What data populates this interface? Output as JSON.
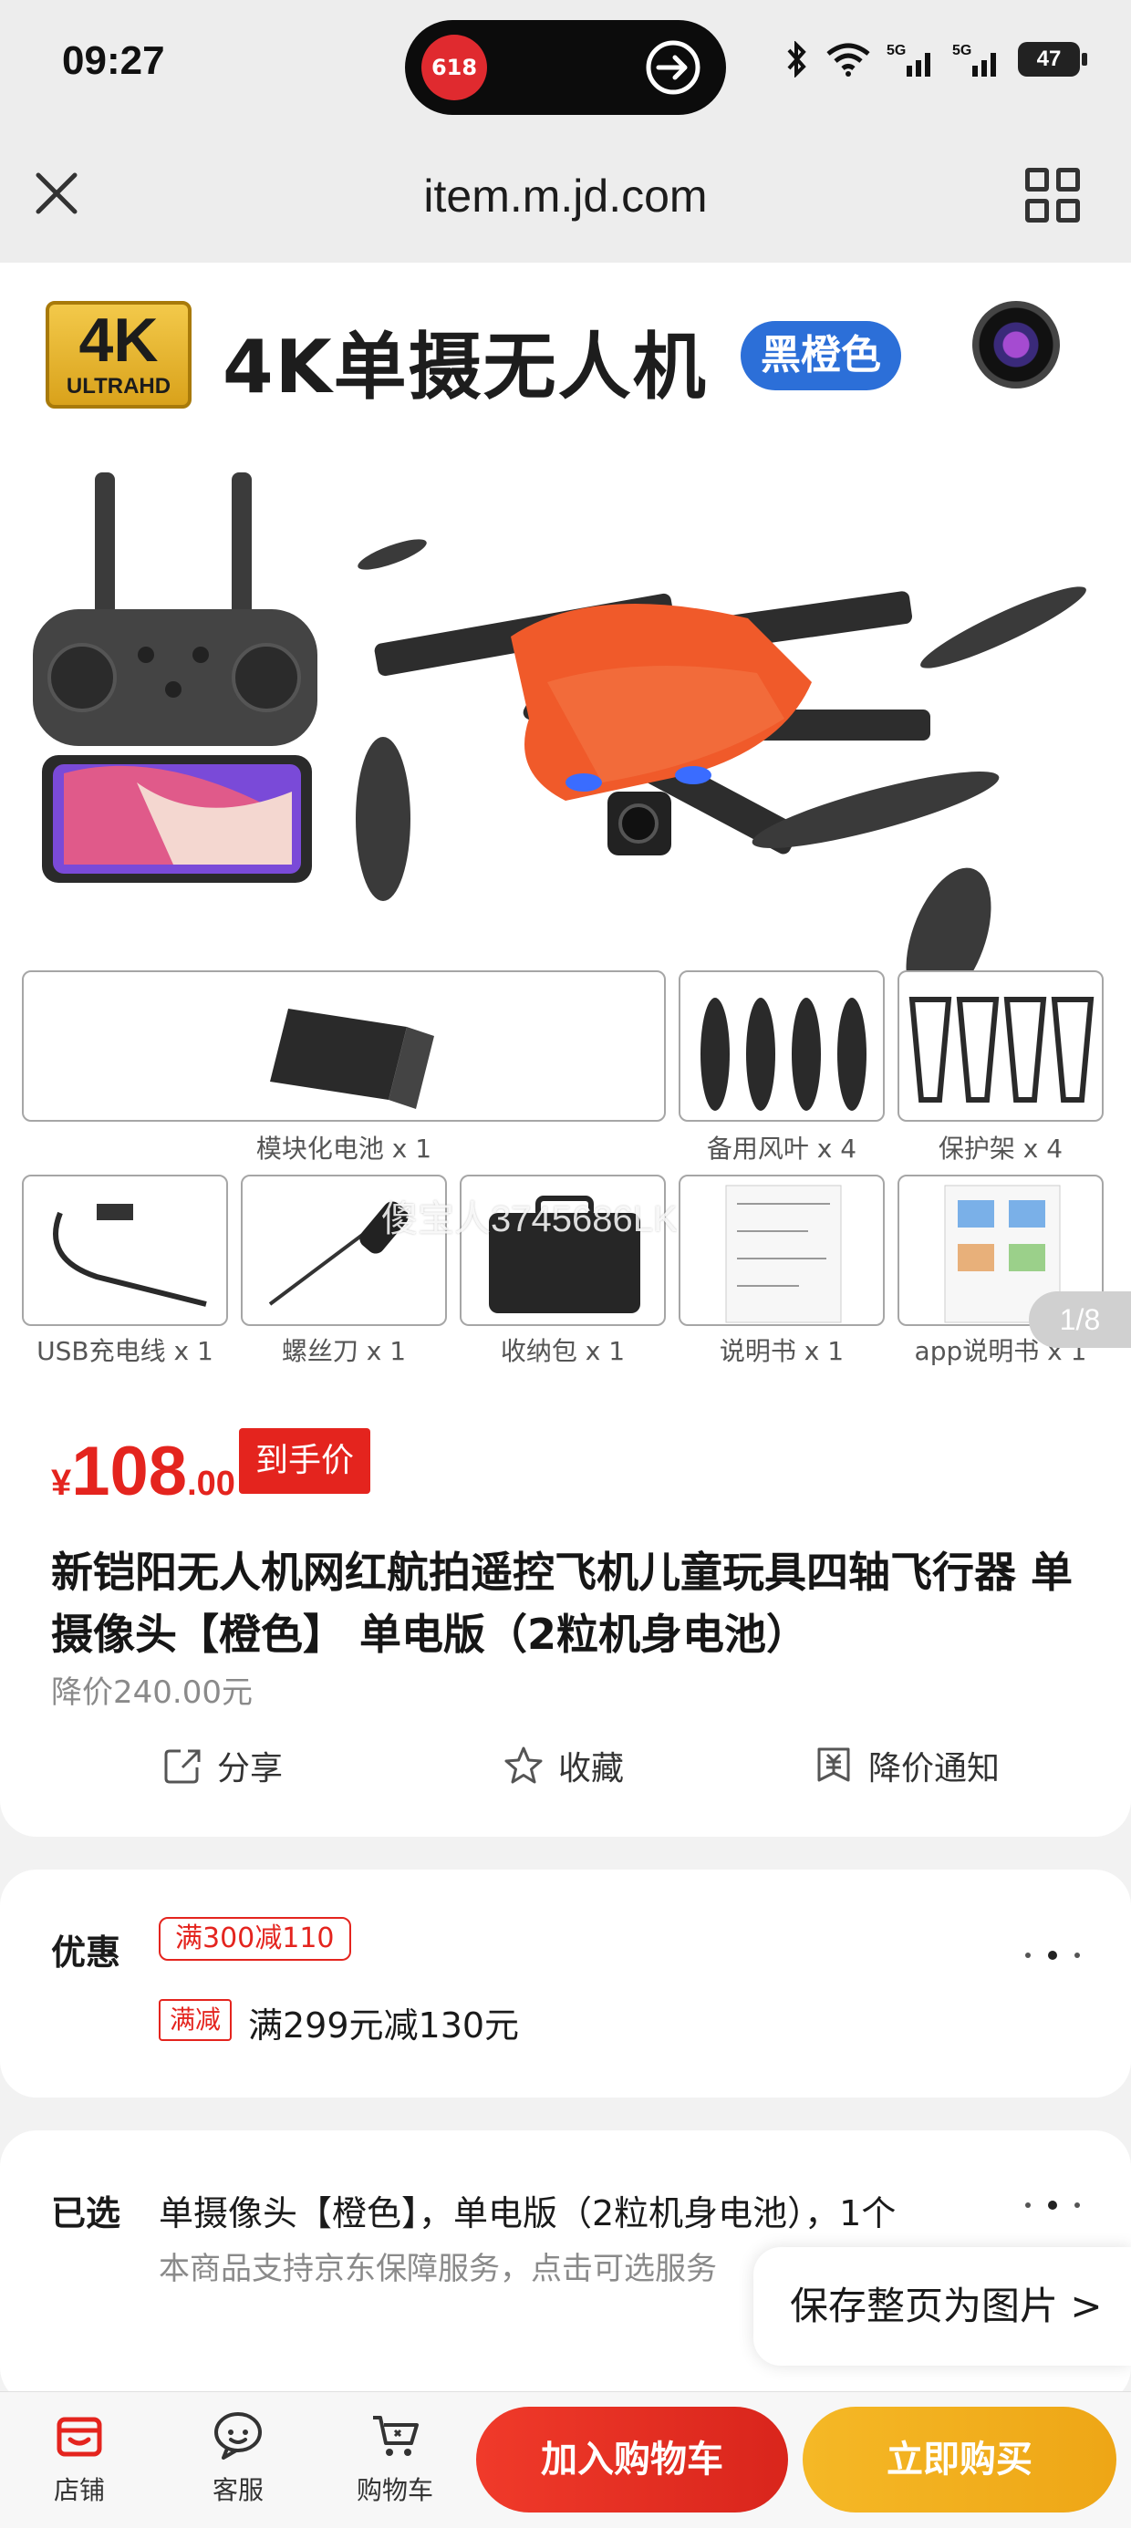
{
  "status_bar": {
    "time": "09:27",
    "battery": "47",
    "island_badge": "618"
  },
  "browser": {
    "url": "item.m.jd.com"
  },
  "product_image": {
    "hero_title": "4K单摄无人机",
    "badge_4k": "4K",
    "badge_ultrahd": "ULTRAHD",
    "color_pill": "黑橙色",
    "watermark": "傻宝人3745686LK",
    "pager": "1/8",
    "accessories": [
      "模块化电池 x 1",
      "备用风叶 x 4",
      "保护架 x 4",
      "USB充电线 x 1",
      "螺丝刀 x 1",
      "收纳包 x 1",
      "说明书 x 1",
      "app说明书 x 1"
    ]
  },
  "price": {
    "currency": "¥",
    "integer": "108",
    "decimal": ".00",
    "tag": "到手价",
    "original": "降价240.00元"
  },
  "title": "新铠阳无人机网红航拍遥控飞机儿童玩具四轴飞行器 单摄像头【橙色】 单电版（2粒机身电池）",
  "actions": {
    "share": "分享",
    "favorite": "收藏",
    "price_alert": "降价通知"
  },
  "promo": {
    "label": "优惠",
    "coupon": "满300减110",
    "tag": "满减",
    "text": "满299元减130元"
  },
  "selected": {
    "label": "已选",
    "value": "单摄像头【橙色】，单电版（2粒机身电池），1个",
    "sub": "本商品支持京东保障服务，点击可选服务"
  },
  "save_page": "保存整页为图片 >",
  "bottom_bar": {
    "shop": "店铺",
    "service": "客服",
    "cart": "购物车",
    "add_to_cart": "加入购物车",
    "buy_now": "立即购买"
  },
  "colors": {
    "accent_red": "#e4241e",
    "buy_yellow": "#eea616",
    "drone_orange": "#f05a2a"
  }
}
